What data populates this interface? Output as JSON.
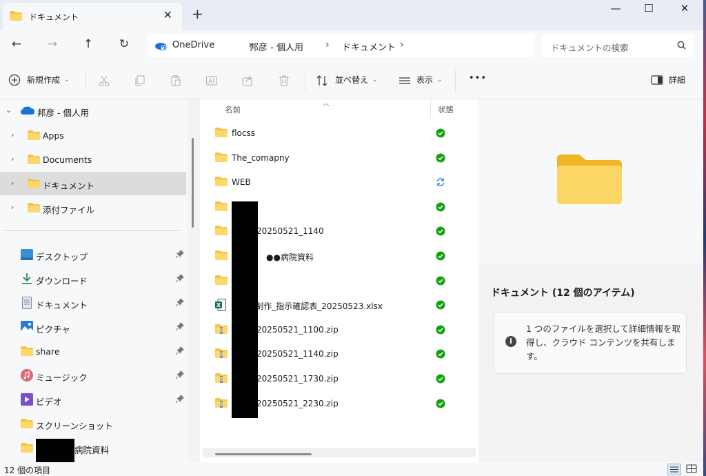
{
  "window": {
    "tab_title": "ドキュメント",
    "new_tab": "+",
    "controls": {
      "minimize": "—",
      "maximize": "☐",
      "close": "✕"
    }
  },
  "nav": {
    "back": "←",
    "forward": "→",
    "up": "↑",
    "refresh": "↻",
    "breadcrumb": [
      "OneDrive",
      "邦彦 - 個人用",
      "ドキュメント"
    ],
    "search_placeholder": "ドキュメントの検索"
  },
  "toolbar": {
    "new": "新規作成",
    "sort": "並べ替え",
    "view": "表示",
    "more": "•••",
    "details": "詳細"
  },
  "sidebar": {
    "root": "邦彦 - 個人用",
    "tree": [
      {
        "label": "Apps",
        "selected": false
      },
      {
        "label": "Documents",
        "selected": false
      },
      {
        "label": "ドキュメント",
        "selected": true
      },
      {
        "label": "添付ファイル",
        "selected": false
      }
    ],
    "quick_access": [
      {
        "label": "デスクトップ",
        "icon": "desktop-icon",
        "pinned": true
      },
      {
        "label": "ダウンロード",
        "icon": "download-icon",
        "pinned": true
      },
      {
        "label": "ドキュメント",
        "icon": "document-icon",
        "pinned": true
      },
      {
        "label": "ピクチャ",
        "icon": "pictures-icon",
        "pinned": true
      },
      {
        "label": "share",
        "icon": "folder-icon",
        "pinned": true
      },
      {
        "label": "ミュージック",
        "icon": "music-icon",
        "pinned": true
      },
      {
        "label": "ビデオ",
        "icon": "video-icon",
        "pinned": true
      },
      {
        "label": "スクリーンショット",
        "icon": "folder-icon",
        "pinned": false
      },
      {
        "label": "病院資料",
        "icon": "folder-icon",
        "pinned": false
      }
    ]
  },
  "filelist": {
    "col_name": "名前",
    "col_status": "状態",
    "rows": [
      {
        "name": "flocss",
        "type": "folder",
        "status": "synced"
      },
      {
        "name": "The_comapny",
        "type": "folder",
        "status": "synced"
      },
      {
        "name": "WEB",
        "type": "folder",
        "status": "syncing"
      },
      {
        "name": "",
        "type": "folder",
        "status": "synced"
      },
      {
        "name": "20250521_1140",
        "type": "folder",
        "status": "synced"
      },
      {
        "name": "●●病院資料",
        "type": "folder",
        "status": "synced"
      },
      {
        "name": "",
        "type": "folder",
        "status": "synced"
      },
      {
        "name": "B制作_指示確認表_20250523.xlsx",
        "type": "excel",
        "status": "synced"
      },
      {
        "name": "20250521_1100.zip",
        "type": "zip",
        "status": "synced"
      },
      {
        "name": "20250521_1140.zip",
        "type": "zip",
        "status": "synced"
      },
      {
        "name": "20250521_1730.zip",
        "type": "zip",
        "status": "synced"
      },
      {
        "name": "20250521_2230.zip",
        "type": "zip",
        "status": "synced"
      }
    ]
  },
  "details": {
    "title": "ドキュメント (12 個のアイテム)",
    "info": "1 つのファイルを選択して詳細情報を取得し、クラウド コンテンツを共有します。",
    "info_icon": "i"
  },
  "statusbar": {
    "count": "12 個の項目"
  },
  "colors": {
    "folder": "#f6c34a",
    "synced": "#13a10e",
    "syncing": "#1a73d9",
    "selection": "#dcdcdc"
  }
}
